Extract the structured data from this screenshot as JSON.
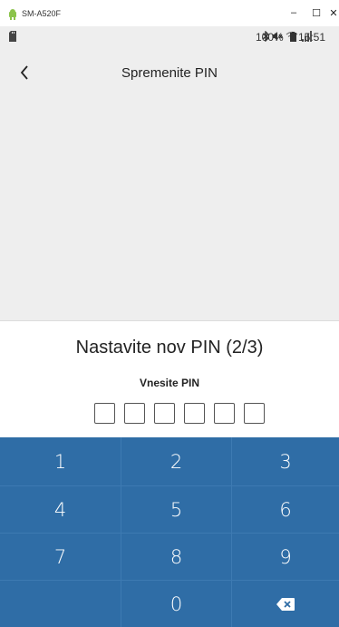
{
  "window": {
    "title": "SM-A520F",
    "minimize_label": "–",
    "maximize_label": "☐",
    "close_label": "✕",
    "app_icon": "android-icon"
  },
  "status_bar": {
    "left_icon": "sd-card-icon",
    "icons": [
      "bluetooth-icon",
      "mute-icon",
      "wifi-icon",
      "signal-icon"
    ],
    "battery_percent": "100%",
    "time": "15:51"
  },
  "app_bar": {
    "back_icon": "chevron-left-icon",
    "title": "Spremenite PIN"
  },
  "pin_setup": {
    "heading": "Nastavite nov PIN (2/3)",
    "prompt": "Vnesite PIN",
    "digit_count": 6
  },
  "keypad": {
    "keys": [
      "1",
      "2",
      "3",
      "4",
      "5",
      "6",
      "7",
      "8",
      "9",
      "",
      "0",
      "backspace"
    ],
    "backspace_icon": "backspace-icon",
    "color": "#2f6da6"
  },
  "colors": {
    "app_background": "#eeeeee",
    "keypad": "#2f6da6"
  }
}
